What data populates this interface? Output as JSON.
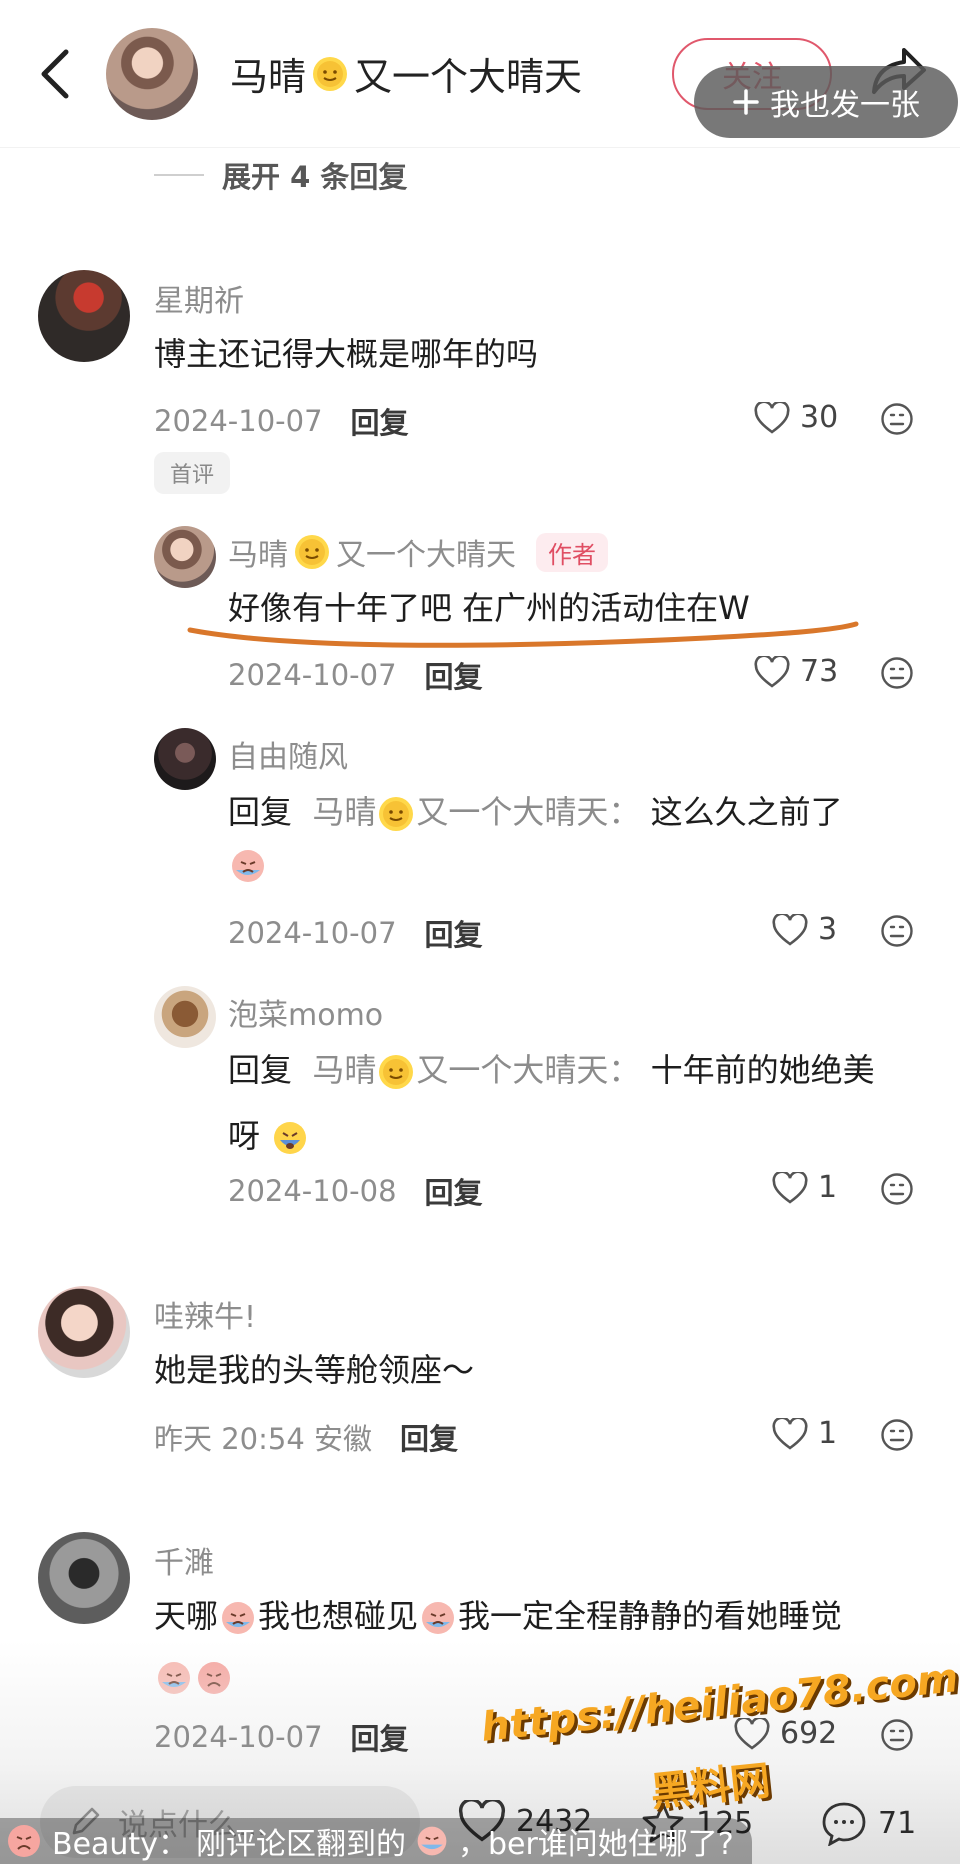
{
  "header": {
    "username": "马晴",
    "username_suffix": "又一个大晴天",
    "follow_label": "关注",
    "post_pill_label": "我也发一张",
    "post_pill_icon": "plus-icon"
  },
  "expand_replies": "展开 4 条回复",
  "comments": [
    {
      "user": "星期祈",
      "text": "博主还记得大概是哪年的吗",
      "date": "2024-10-07",
      "reply_label": "回复",
      "likes": "30",
      "badge": "首评"
    },
    {
      "user": "马晴",
      "user_suffix": "又一个大晴天",
      "author_badge": "作者",
      "text": "好像有十年了吧 在广州的活动住在W",
      "date": "2024-10-07",
      "reply_label": "回复",
      "likes": "73"
    },
    {
      "user": "自由随风",
      "reply_prefix": "回复",
      "mention": "马晴",
      "mention_suffix": "又一个大晴天：",
      "text": "这么久之前了",
      "date": "2024-10-07",
      "reply_label": "回复",
      "likes": "3"
    },
    {
      "user": "泡菜momo",
      "reply_prefix": "回复",
      "mention": "马晴",
      "mention_suffix": "又一个大晴天：",
      "text": "十年前的她绝美",
      "text_line2": "呀",
      "date": "2024-10-08",
      "reply_label": "回复",
      "likes": "1"
    },
    {
      "user": "哇辣牛!",
      "text": "她是我的头等舱领座～",
      "date": "昨天 20:54 安徽",
      "reply_label": "回复",
      "likes": "1"
    },
    {
      "user": "千濉",
      "text_a": "天哪",
      "text_b": "我也想碰见",
      "text_c": "我一定全程静静的看她睡觉",
      "date": "2024-10-07",
      "reply_label": "回复",
      "likes": "692"
    }
  ],
  "bottom_bar": {
    "input_placeholder": "说点什么...",
    "likes_count": "2432",
    "stars_count": "125",
    "comments_count": "71"
  },
  "danmaku": {
    "user": "Beauty：",
    "text_a": "刚评论区翻到的",
    "text_b": "，ber谁问她住哪了?"
  },
  "watermark": {
    "url": "https://heiliao78.com",
    "name": "黑料网"
  },
  "colors": {
    "accent": "#e0586c",
    "underline": "#d9772b",
    "watermark": "#f6a722"
  }
}
